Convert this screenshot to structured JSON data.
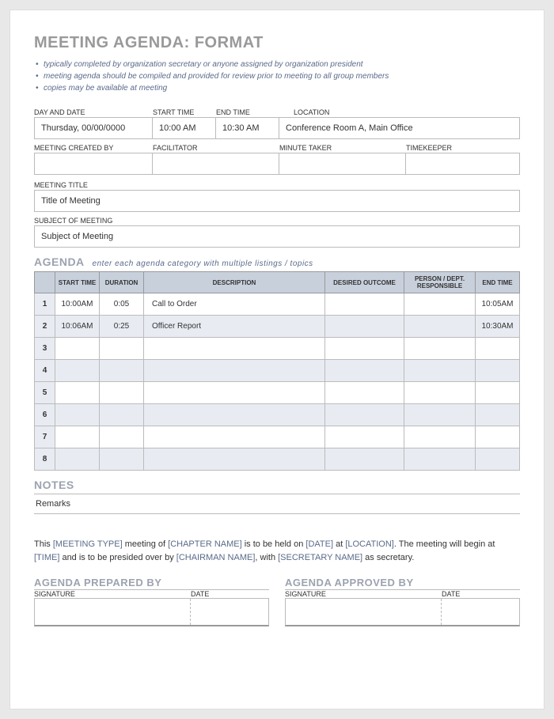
{
  "title": "MEETING AGENDA: FORMAT",
  "bullets": [
    "typically completed by organization secretary or anyone assigned by organization president",
    "meeting agenda should be compiled and provided for review prior to meeting to all group members",
    "copies may be available at meeting"
  ],
  "labels": {
    "day_date": "DAY AND DATE",
    "start_time": "START TIME",
    "end_time": "END TIME",
    "location": "LOCATION",
    "created_by": "MEETING CREATED BY",
    "facilitator": "FACILITATOR",
    "minute_taker": "MINUTE TAKER",
    "timekeeper": "TIMEKEEPER",
    "meeting_title": "MEETING TITLE",
    "subject": "SUBJECT OF MEETING",
    "agenda": "AGENDA",
    "agenda_hint": "enter each agenda category with multiple listings / topics",
    "notes": "NOTES",
    "prepared_by": "AGENDA PREPARED BY",
    "approved_by": "AGENDA APPROVED BY",
    "signature": "SIGNATURE",
    "date": "DATE"
  },
  "info": {
    "day_date": "Thursday, 00/00/0000",
    "start_time": "10:00 AM",
    "end_time": "10:30 AM",
    "location": "Conference Room A, Main Office",
    "created_by": "",
    "facilitator": "",
    "minute_taker": "",
    "timekeeper": "",
    "meeting_title": "Title of Meeting",
    "subject": "Subject of Meeting"
  },
  "agenda_headers": {
    "num": "",
    "start": "START TIME",
    "duration": "DURATION",
    "description": "DESCRIPTION",
    "outcome": "DESIRED OUTCOME",
    "person": "PERSON / DEPT. RESPONSIBLE",
    "end": "END TIME"
  },
  "agenda_rows": [
    {
      "num": "1",
      "start": "10:00AM",
      "dur": "0:05",
      "desc": "Call to Order",
      "out": "",
      "person": "",
      "end": "10:05AM"
    },
    {
      "num": "2",
      "start": "10:06AM",
      "dur": "0:25",
      "desc": "Officer Report",
      "out": "",
      "person": "",
      "end": "10:30AM"
    },
    {
      "num": "3",
      "start": "",
      "dur": "",
      "desc": "",
      "out": "",
      "person": "",
      "end": ""
    },
    {
      "num": "4",
      "start": "",
      "dur": "",
      "desc": "",
      "out": "",
      "person": "",
      "end": ""
    },
    {
      "num": "5",
      "start": "",
      "dur": "",
      "desc": "",
      "out": "",
      "person": "",
      "end": ""
    },
    {
      "num": "6",
      "start": "",
      "dur": "",
      "desc": "",
      "out": "",
      "person": "",
      "end": ""
    },
    {
      "num": "7",
      "start": "",
      "dur": "",
      "desc": "",
      "out": "",
      "person": "",
      "end": ""
    },
    {
      "num": "8",
      "start": "",
      "dur": "",
      "desc": "",
      "out": "",
      "person": "",
      "end": ""
    }
  ],
  "notes": "Remarks",
  "footer": {
    "text_parts": {
      "p1": "This ",
      "ph1": "[MEETING TYPE]",
      "p2": " meeting of ",
      "ph2": "[CHAPTER NAME]",
      "p3": " is to be held on ",
      "ph3": "[DATE]",
      "p4": " at ",
      "ph4": "[LOCATION]",
      "p5": ".  The meeting will begin at ",
      "ph5": "[TIME]",
      "p6": " and is to be presided over by ",
      "ph6": "[CHAIRMAN NAME]",
      "p7": ", with ",
      "ph7": "[SECRETARY NAME]",
      "p8": " as secretary."
    }
  }
}
